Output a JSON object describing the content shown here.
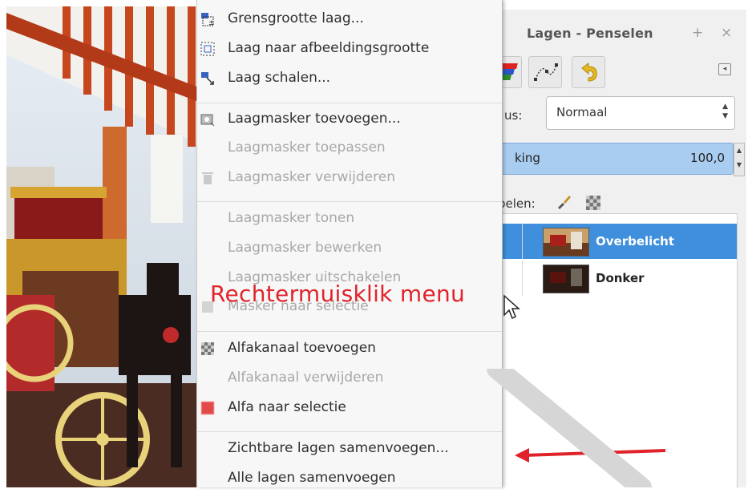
{
  "context_menu": {
    "items": [
      {
        "label": "Grensgrootte laag...",
        "enabled": true,
        "icon": "layer-boundary-icon"
      },
      {
        "label": "Laag naar afbeeldingsgrootte",
        "enabled": true,
        "icon": "layer-to-image-size-icon"
      },
      {
        "label": "Laag schalen...",
        "enabled": true,
        "icon": "scale-layer-icon"
      },
      {
        "label": "Laagmasker toevoegen...",
        "enabled": true,
        "icon": "add-layer-mask-icon"
      },
      {
        "label": "Laagmasker toepassen",
        "enabled": false,
        "icon": ""
      },
      {
        "label": "Laagmasker verwijderen",
        "enabled": false,
        "icon": "trash-icon"
      },
      {
        "label": "Laagmasker tonen",
        "enabled": false,
        "icon": ""
      },
      {
        "label": "Laagmasker bewerken",
        "enabled": false,
        "icon": ""
      },
      {
        "label": "Laagmasker uitschakelen",
        "enabled": false,
        "icon": ""
      },
      {
        "label": "Masker naar selectie",
        "enabled": false,
        "icon": "mask-to-selection-icon"
      },
      {
        "label": "Alfakanaal toevoegen",
        "enabled": true,
        "icon": "add-alpha-channel-icon"
      },
      {
        "label": "Alfakanaal verwijderen",
        "enabled": false,
        "icon": ""
      },
      {
        "label": "Alfa naar selectie",
        "enabled": true,
        "icon": "alpha-to-selection-icon"
      },
      {
        "label": "Zichtbare lagen samenvoegen...",
        "enabled": true,
        "icon": ""
      },
      {
        "label": "Alle lagen samenvoegen",
        "enabled": true,
        "icon": ""
      }
    ]
  },
  "annotation": {
    "text": "Rechtermuisklik menu",
    "color": "#e0232b"
  },
  "dock": {
    "title": "Lagen - Penselen",
    "add_symbol": "+",
    "close_symbol": "×",
    "mode_label": "us:",
    "mode_value": "Normaal",
    "opacity_label": "king",
    "opacity_value": "100,0",
    "lock_label": "pelen:",
    "tabs": [
      "layers-tab-icon",
      "paths-tab-icon",
      "undo-tab-icon"
    ],
    "layers": [
      {
        "name": "Overbelicht",
        "selected": true
      },
      {
        "name": "Donker",
        "selected": false
      }
    ]
  },
  "colors": {
    "selection": "#3f8fdc",
    "opacity_bar": "#a9cdf0",
    "annotation": "#e0232b"
  }
}
